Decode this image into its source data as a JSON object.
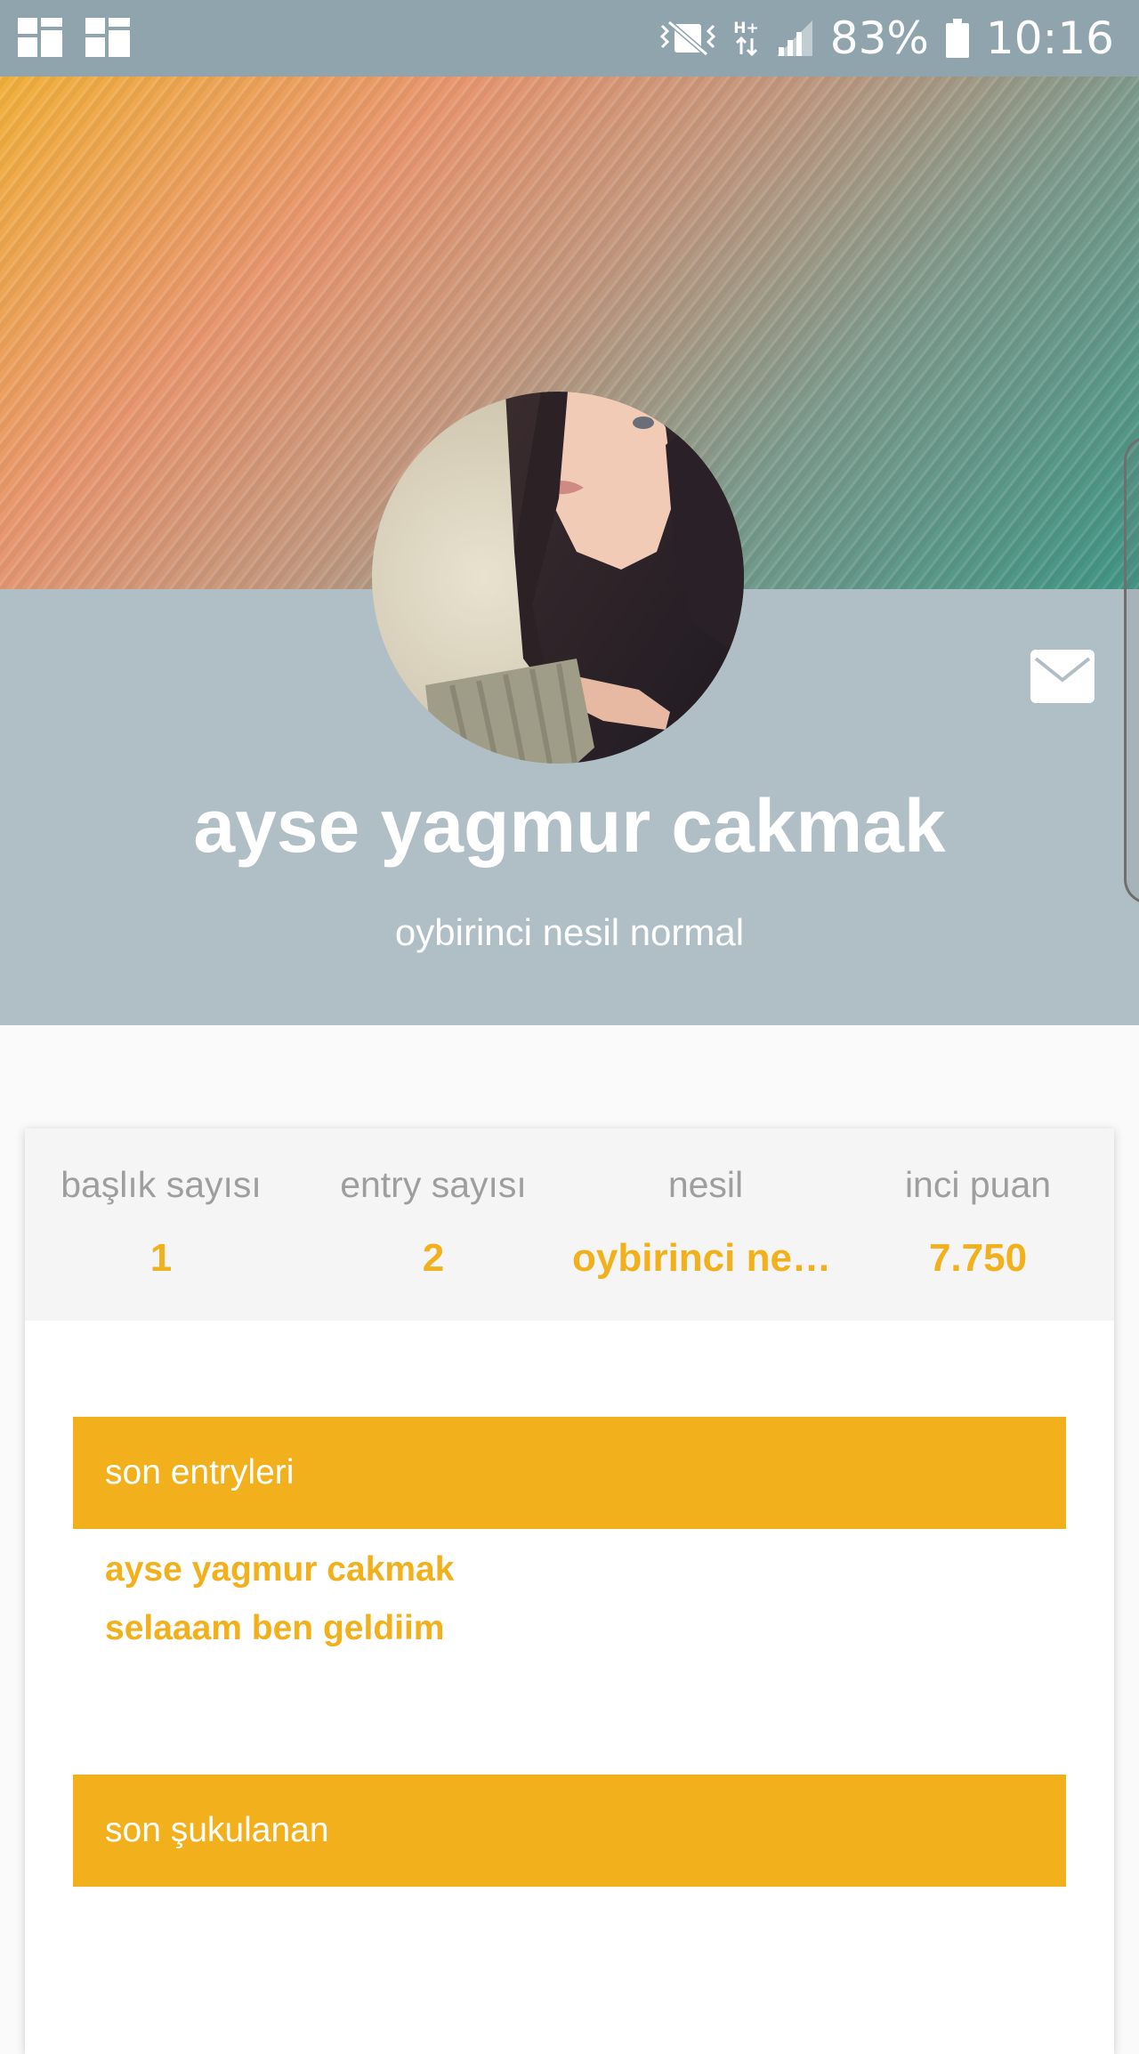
{
  "status_bar": {
    "battery_text": "83%",
    "time": "10:16",
    "network_label": "H+",
    "icons": [
      "notification-icon",
      "notification-icon",
      "vibrate-icon",
      "network-icon",
      "signal-icon",
      "battery-icon"
    ]
  },
  "profile": {
    "name": "ayse yagmur cakmak",
    "subtitle": "oybirinci nesil normal",
    "avatar_icon": "avatar",
    "mail_icon": "mail-icon"
  },
  "stats": [
    {
      "label": "başlık sayısı",
      "value": "1"
    },
    {
      "label": "entry sayısı",
      "value": "2"
    },
    {
      "label": "nesil",
      "value": "oybirinci nesil normal"
    },
    {
      "label": "inci puan",
      "value": "7.750"
    }
  ],
  "sections": {
    "recent_entries": {
      "title": "son entryleri",
      "items": [
        "ayse yagmur cakmak",
        "selaaam ben geldiim"
      ]
    },
    "recent_liked": {
      "title": "son şukulanan"
    }
  },
  "colors": {
    "status_bar": "#90a4ae",
    "profile_band": "#b0bec5",
    "accent": "#f2b01d",
    "stat_label": "#9e9e9e"
  }
}
